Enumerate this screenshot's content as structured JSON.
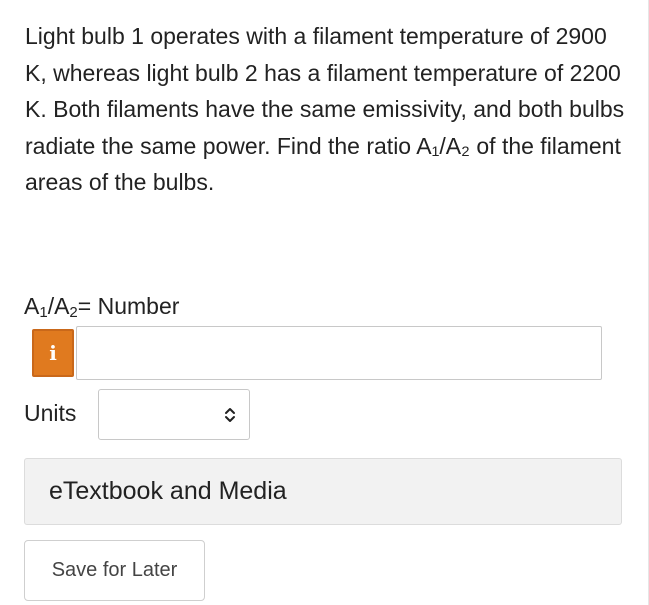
{
  "question": {
    "text": "Light bulb 1 operates with a filament temperature of 2900 K, whereas light bulb 2 has a filament temperature of 2200 K. Both filaments have the same emissivity, and both bulbs radiate the same power. Find the ratio A₁/A₂ of the filament areas of the bulbs."
  },
  "answer": {
    "label_a": "A",
    "label_sub1": "1",
    "label_slash": "/A",
    "label_sub2": "2",
    "label_suffix": "= Number",
    "info_glyph": "i",
    "info_color": "#e07a1f",
    "value": ""
  },
  "units": {
    "label": "Units",
    "selected": ""
  },
  "etextbook": {
    "label": "eTextbook and Media"
  },
  "save": {
    "label": "Save for Later"
  }
}
